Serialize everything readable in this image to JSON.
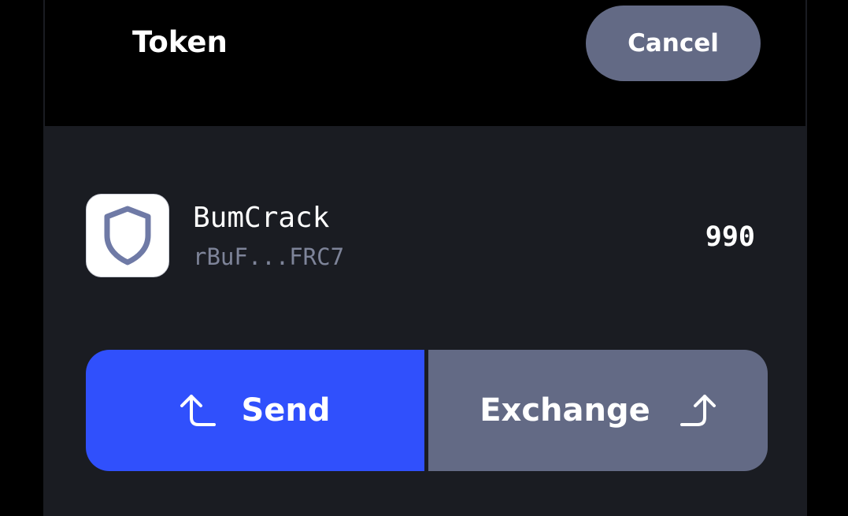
{
  "header": {
    "title": "Token",
    "cancel_label": "Cancel"
  },
  "token": {
    "icon": "shield-icon",
    "name": "BumCrack",
    "address": "rBuF...FRC7",
    "balance": "990"
  },
  "actions": {
    "send_label": "Send",
    "send_icon": "arrow-up-left-icon",
    "exchange_label": "Exchange",
    "exchange_icon": "arrow-up-right-icon"
  },
  "colors": {
    "send_button": "#3050fc",
    "secondary_button": "#636a85",
    "panel_background": "#1a1c22",
    "address_text": "#7e8499"
  }
}
